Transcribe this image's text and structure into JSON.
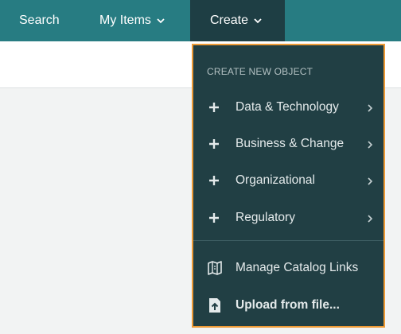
{
  "nav": {
    "search_label": "Search",
    "my_items_label": "My Items",
    "create_label": "Create"
  },
  "dropdown": {
    "section_title": "CREATE NEW OBJECT",
    "items": [
      {
        "label": "Data & Technology",
        "icon": "plus-icon"
      },
      {
        "label": "Business & Change",
        "icon": "plus-icon"
      },
      {
        "label": "Organizational",
        "icon": "plus-icon"
      },
      {
        "label": "Regulatory",
        "icon": "plus-icon"
      }
    ],
    "actions": [
      {
        "label": "Manage Catalog Links",
        "icon": "catalog-map-icon"
      },
      {
        "label": "Upload from file...",
        "icon": "upload-file-icon"
      }
    ]
  },
  "colors": {
    "topbar": "#277c82",
    "active_tab": "#1e3e44",
    "dropdown_bg": "#213f44",
    "highlight_border": "#ee9a35"
  }
}
